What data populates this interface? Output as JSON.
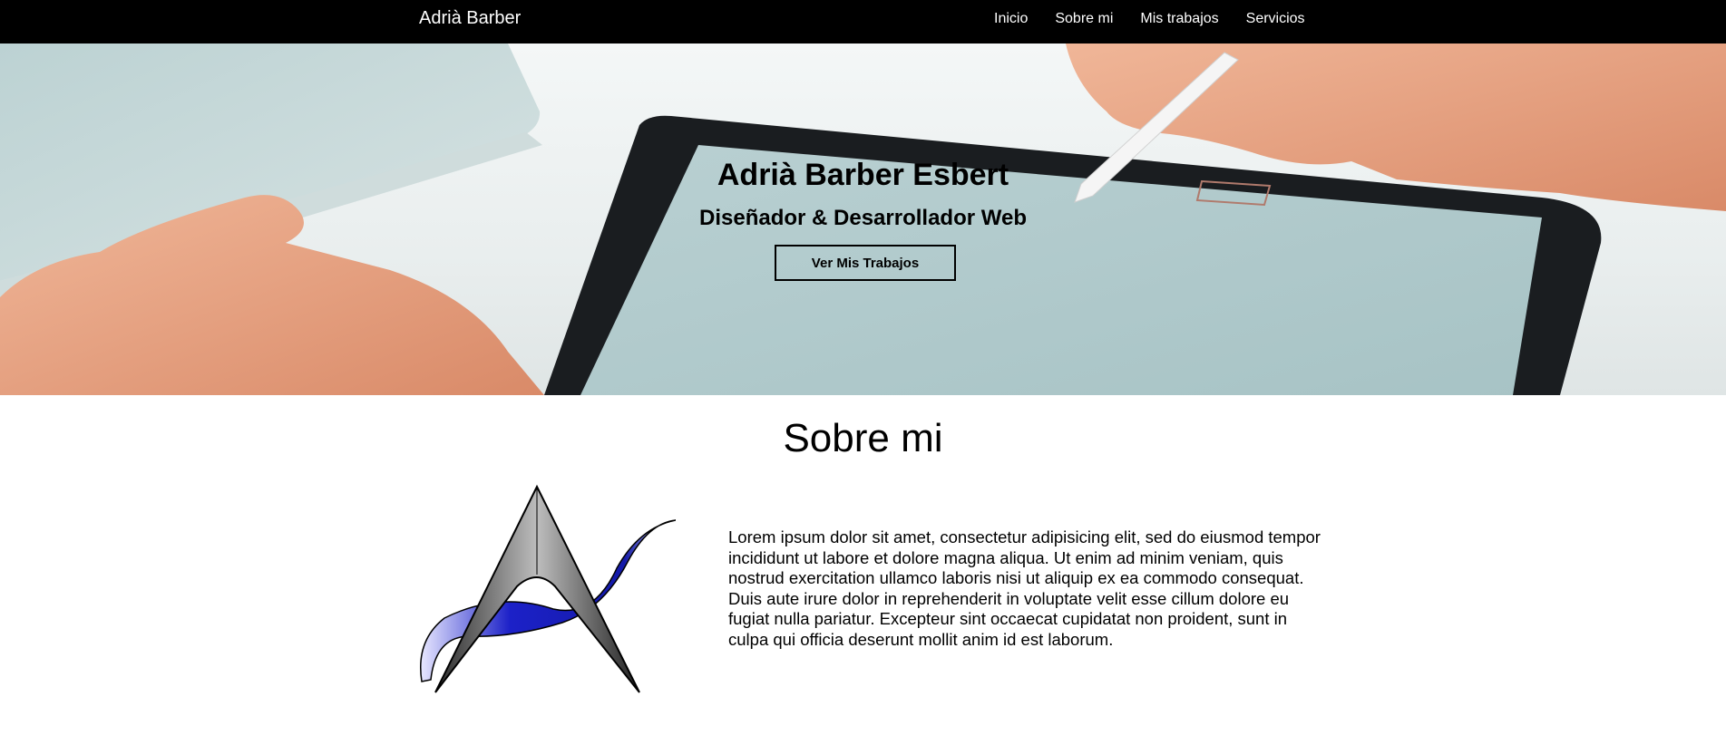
{
  "navbar": {
    "brand": "Adrià Barber",
    "links": [
      "Inicio",
      "Sobre mi",
      "Mis trabajos",
      "Servicios"
    ]
  },
  "hero": {
    "title": "Adrià Barber Esbert",
    "subtitle": "Diseñador & Desarrollador Web",
    "button_label": "Ver Mis Trabajos"
  },
  "about": {
    "title": "Sobre mi",
    "paragraph": "Lorem ipsum dolor sit amet, consectetur adipisicing elit, sed do eiusmod tempor incididunt ut labore et dolore magna aliqua. Ut enim ad minim veniam, quis nostrud exercitation ullamco laboris nisi ut aliquip ex ea commodo consequat. Duis aute irure dolor in reprehenderit in voluptate velit esse cillum dolore eu fugiat nulla pariatur. Excepteur sint occaecat cupidatat non proident, sunt in culpa qui officia deserunt mollit anim id est laborum."
  },
  "colors": {
    "navbar_bg": "#000000",
    "nav_text": "#ffffff",
    "logo_blue": "#1c21c8"
  },
  "icons": {
    "logo": "ab-monogram-logo"
  }
}
